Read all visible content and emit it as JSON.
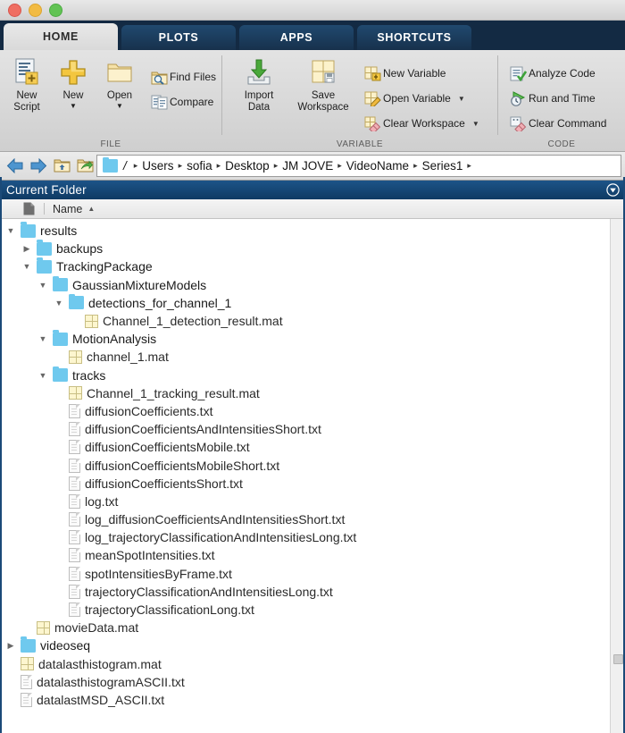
{
  "window": {
    "controls": [
      {
        "name": "close",
        "color": "#ef6e62"
      },
      {
        "name": "minimize",
        "color": "#f2bb43"
      },
      {
        "name": "maximize",
        "color": "#62c354"
      }
    ]
  },
  "ribbon": {
    "tabs": [
      {
        "label": "HOME",
        "active": true
      },
      {
        "label": "PLOTS",
        "active": false
      },
      {
        "label": "APPS",
        "active": false
      },
      {
        "label": "SHORTCUTS",
        "active": false
      }
    ],
    "groups": [
      {
        "label": "FILE",
        "big": [
          {
            "label": "New\nScript",
            "icon": "new-script-icon",
            "caret": false
          },
          {
            "label": "New",
            "icon": "new-icon",
            "caret": true
          },
          {
            "label": "Open",
            "icon": "open-folder-icon",
            "caret": true
          }
        ],
        "small": [
          {
            "label": "Find Files",
            "icon": "find-files-icon",
            "caret": false
          },
          {
            "label": "Compare",
            "icon": "compare-icon",
            "caret": false
          }
        ]
      },
      {
        "label": "VARIABLE",
        "big": [
          {
            "label": "Import\nData",
            "icon": "import-data-icon",
            "caret": false
          },
          {
            "label": "Save\nWorkspace",
            "icon": "save-workspace-icon",
            "caret": false
          }
        ],
        "small": [
          {
            "label": "New Variable",
            "icon": "new-variable-icon",
            "caret": false
          },
          {
            "label": "Open Variable",
            "icon": "open-variable-icon",
            "caret": true
          },
          {
            "label": "Clear Workspace",
            "icon": "clear-workspace-icon",
            "caret": true
          }
        ]
      },
      {
        "label": "CODE",
        "big": [],
        "small": [
          {
            "label": "Analyze Code",
            "icon": "analyze-code-icon",
            "caret": false
          },
          {
            "label": "Run and Time",
            "icon": "run-and-time-icon",
            "caret": false
          },
          {
            "label": "Clear Command",
            "icon": "clear-command-icon",
            "caret": false
          }
        ]
      }
    ]
  },
  "address": {
    "back_icon": "back-arrow-icon",
    "forward_icon": "forward-arrow-icon",
    "up_icon": "up-folder-icon",
    "browse_icon": "browse-folder-icon",
    "folder_icon": "folder-icon",
    "root": "/",
    "crumbs": [
      "Users",
      "sofia",
      "Desktop",
      "JM JOVE",
      "VideoName",
      "Series1"
    ],
    "trailing_separator": "▸"
  },
  "panel": {
    "title": "Current Folder",
    "menu_icon": "panel-menu-icon",
    "column": {
      "file_icon": "file-icon",
      "name_label": "Name",
      "sort_arrow": "▲"
    }
  },
  "tree": {
    "items": [
      {
        "depth": 0,
        "twisty": "down",
        "icon": "folder",
        "label": "results"
      },
      {
        "depth": 1,
        "twisty": "right",
        "icon": "folder",
        "label": "backups"
      },
      {
        "depth": 1,
        "twisty": "down",
        "icon": "folder",
        "label": "TrackingPackage"
      },
      {
        "depth": 2,
        "twisty": "down",
        "icon": "folder",
        "label": "GaussianMixtureModels"
      },
      {
        "depth": 3,
        "twisty": "down",
        "icon": "folder",
        "label": "detections_for_channel_1"
      },
      {
        "depth": 4,
        "twisty": "none",
        "icon": "mat",
        "label": "Channel_1_detection_result.mat"
      },
      {
        "depth": 2,
        "twisty": "down",
        "icon": "folder",
        "label": "MotionAnalysis"
      },
      {
        "depth": 3,
        "twisty": "none",
        "icon": "mat",
        "label": "channel_1.mat"
      },
      {
        "depth": 2,
        "twisty": "down",
        "icon": "folder",
        "label": "tracks"
      },
      {
        "depth": 3,
        "twisty": "none",
        "icon": "mat",
        "label": "Channel_1_tracking_result.mat"
      },
      {
        "depth": 3,
        "twisty": "none",
        "icon": "txt",
        "label": "diffusionCoefficients.txt"
      },
      {
        "depth": 3,
        "twisty": "none",
        "icon": "txt",
        "label": "diffusionCoefficientsAndIntensitiesShort.txt"
      },
      {
        "depth": 3,
        "twisty": "none",
        "icon": "txt",
        "label": "diffusionCoefficientsMobile.txt"
      },
      {
        "depth": 3,
        "twisty": "none",
        "icon": "txt",
        "label": "diffusionCoefficientsMobileShort.txt"
      },
      {
        "depth": 3,
        "twisty": "none",
        "icon": "txt",
        "label": "diffusionCoefficientsShort.txt"
      },
      {
        "depth": 3,
        "twisty": "none",
        "icon": "txt",
        "label": "log.txt"
      },
      {
        "depth": 3,
        "twisty": "none",
        "icon": "txt",
        "label": "log_diffusionCoefficientsAndIntensitiesShort.txt"
      },
      {
        "depth": 3,
        "twisty": "none",
        "icon": "txt",
        "label": "log_trajectoryClassificationAndIntensitiesLong.txt"
      },
      {
        "depth": 3,
        "twisty": "none",
        "icon": "txt",
        "label": "meanSpotIntensities.txt"
      },
      {
        "depth": 3,
        "twisty": "none",
        "icon": "txt",
        "label": "spotIntensitiesByFrame.txt"
      },
      {
        "depth": 3,
        "twisty": "none",
        "icon": "txt",
        "label": "trajectoryClassificationAndIntensitiesLong.txt"
      },
      {
        "depth": 3,
        "twisty": "none",
        "icon": "txt",
        "label": "trajectoryClassificationLong.txt"
      },
      {
        "depth": 1,
        "twisty": "none",
        "icon": "mat",
        "label": "movieData.mat"
      },
      {
        "depth": 0,
        "twisty": "right",
        "icon": "folder",
        "label": "videoseq"
      },
      {
        "depth": 0,
        "twisty": "none",
        "icon": "mat",
        "label": "datalasthistogram.mat"
      },
      {
        "depth": 0,
        "twisty": "none",
        "icon": "txt",
        "label": "datalasthistogramASCII.txt"
      },
      {
        "depth": 0,
        "twisty": "none",
        "icon": "txt",
        "label": "datalastMSD_ASCII.txt"
      }
    ]
  },
  "colors": {
    "ribbon_tab_bar": "#132a43",
    "panel_header": "#1d5488",
    "folder_icon": "#6fc9ee",
    "mat_icon": "#fdf6cf",
    "accent_border": "#1b4a78"
  }
}
